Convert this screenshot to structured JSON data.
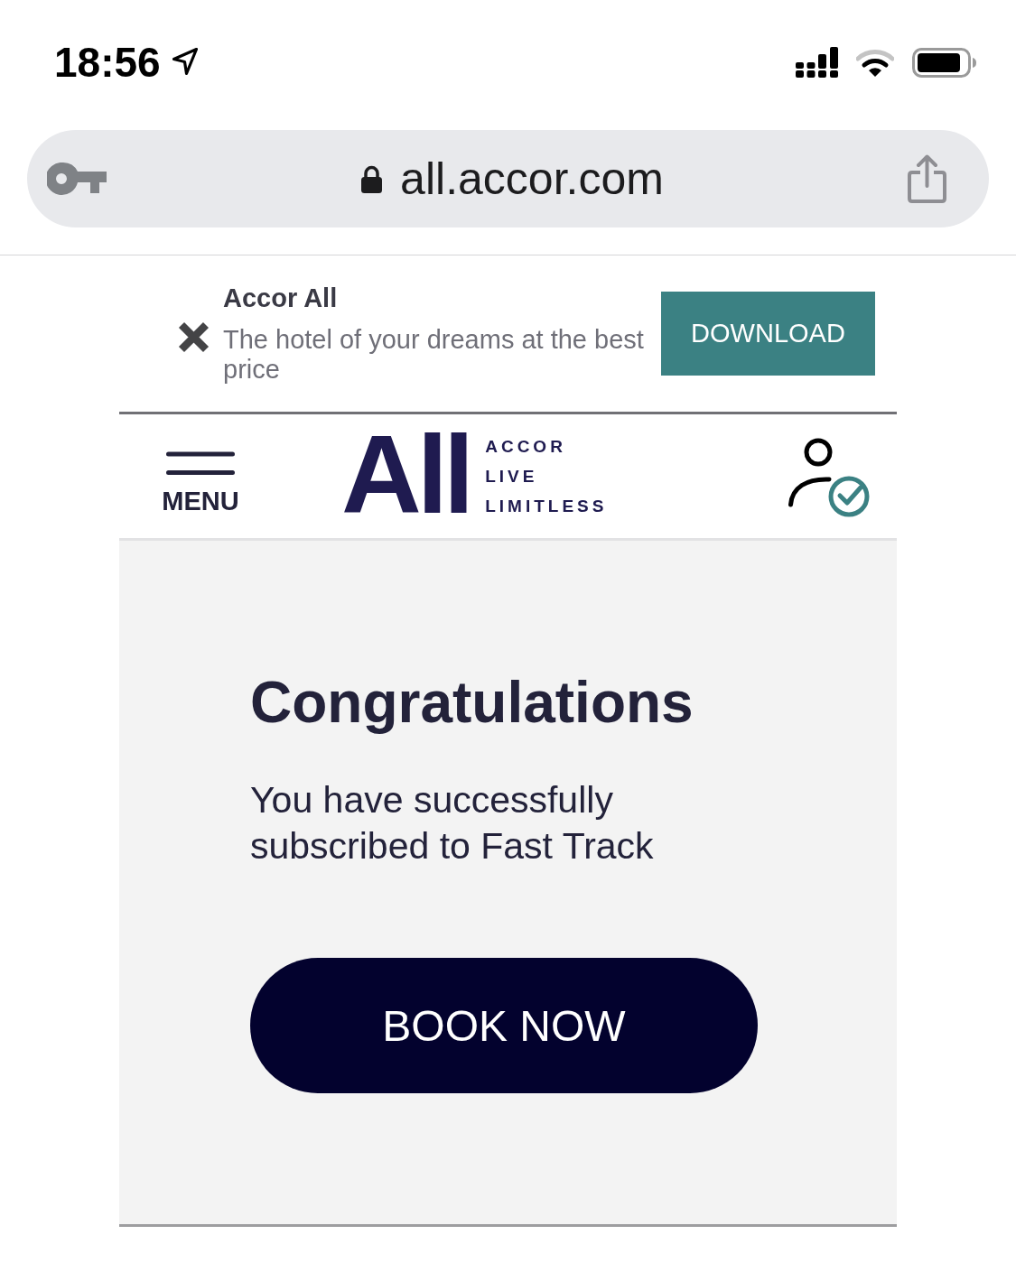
{
  "status_bar": {
    "time": "18:56"
  },
  "address_bar": {
    "url": "all.accor.com"
  },
  "app_banner": {
    "title": "Accor All",
    "description": "The hotel of your dreams at the best price",
    "button": "DOWNLOAD"
  },
  "header": {
    "menu_label": "MENU",
    "logo": {
      "wordmark": "All",
      "tagline": [
        "ACCOR",
        "LIVE",
        "LIMITLESS"
      ]
    }
  },
  "confirmation": {
    "heading": "Congratulations",
    "message": "You have successfully subscribed to Fast Track",
    "button": "BOOK NOW"
  }
}
